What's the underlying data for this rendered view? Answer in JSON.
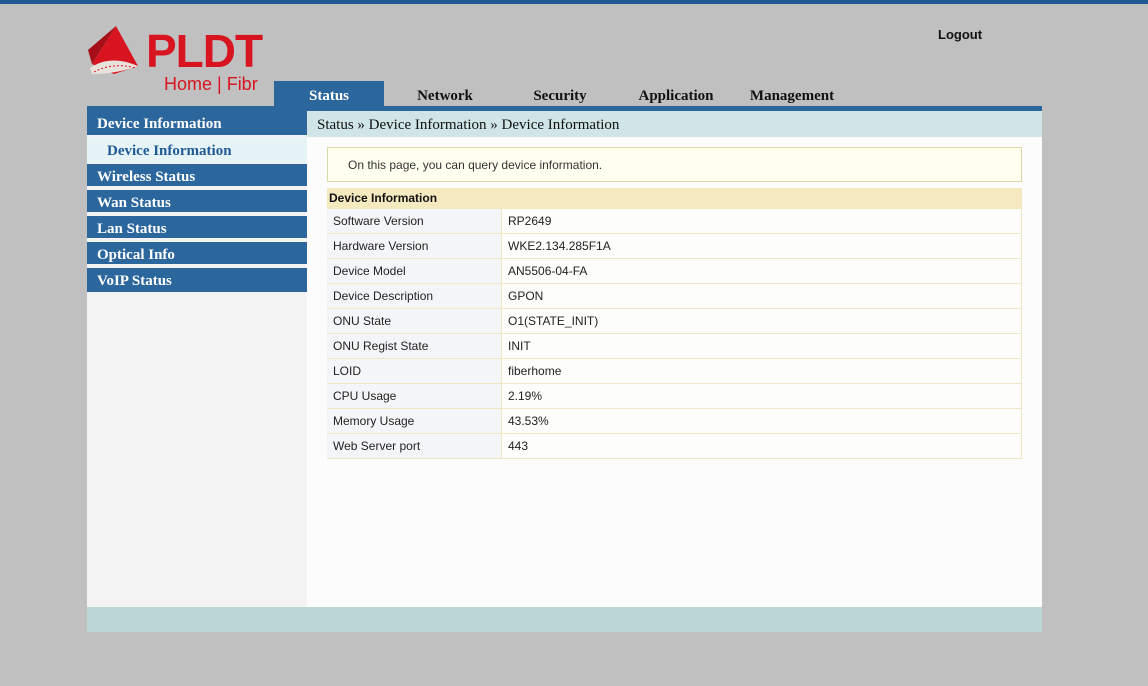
{
  "brand": {
    "main": "PLDT",
    "sub": "Home | Fibr"
  },
  "header": {
    "logout_label": "Logout"
  },
  "nav": {
    "tabs": [
      {
        "label": "Status",
        "active": true
      },
      {
        "label": "Network",
        "active": false
      },
      {
        "label": "Security",
        "active": false
      },
      {
        "label": "Application",
        "active": false
      },
      {
        "label": "Management",
        "active": false
      }
    ]
  },
  "sidebar": {
    "items": [
      {
        "label": "Device Information"
      },
      {
        "label": "Device Information"
      },
      {
        "label": "Wireless Status"
      },
      {
        "label": "Wan Status"
      },
      {
        "label": "Lan Status"
      },
      {
        "label": "Optical Info"
      },
      {
        "label": "VoIP Status"
      }
    ]
  },
  "breadcrumb": "Status » Device Information » Device Information",
  "info_text": "On this page, you can query device information.",
  "device_table": {
    "title": "Device Information",
    "rows": [
      {
        "label": "Software Version",
        "value": "RP2649"
      },
      {
        "label": "Hardware Version",
        "value": "WKE2.134.285F1A"
      },
      {
        "label": "Device Model",
        "value": "AN5506-04-FA"
      },
      {
        "label": "Device Description",
        "value": "GPON"
      },
      {
        "label": "ONU State",
        "value": "O1(STATE_INIT)"
      },
      {
        "label": "ONU Regist State",
        "value": "INIT"
      },
      {
        "label": "LOID",
        "value": "fiberhome"
      },
      {
        "label": "CPU Usage",
        "value": "2.19%"
      },
      {
        "label": "Memory Usage",
        "value": "43.53%"
      },
      {
        "label": "Web Server port",
        "value": "443"
      }
    ]
  },
  "colors": {
    "accent": "#2b669d",
    "brand_red": "#d7141f",
    "breadcrumb_bg": "#cfe5e7"
  }
}
